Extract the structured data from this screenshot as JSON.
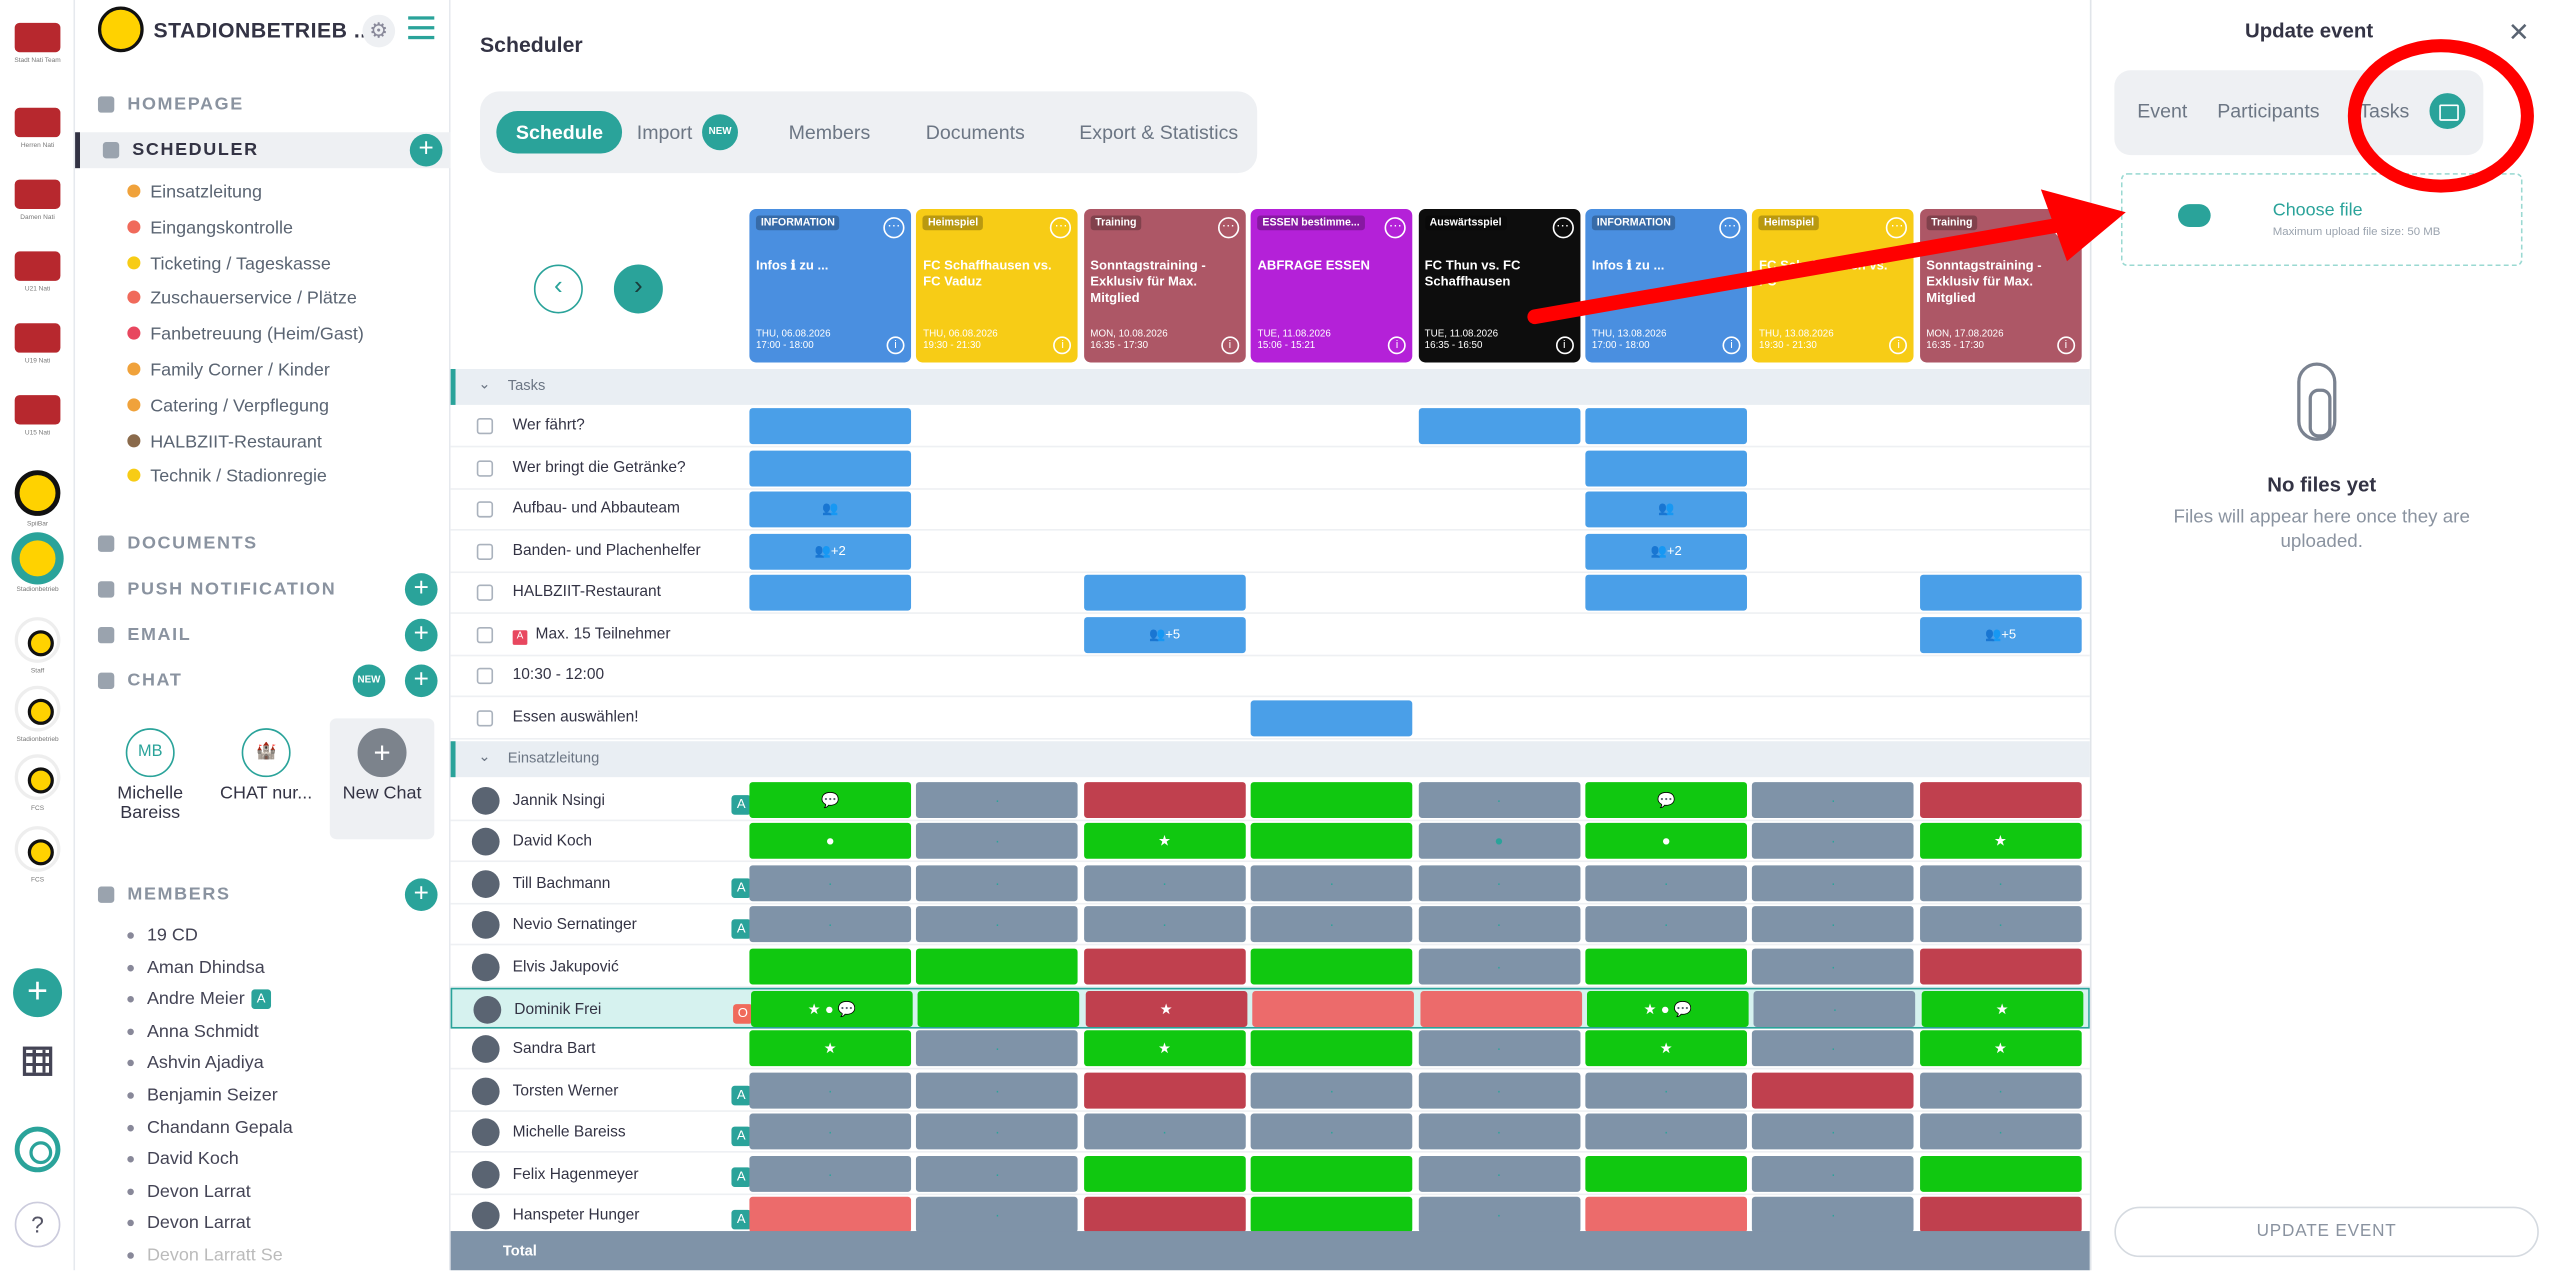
{
  "org": {
    "name": "STADIONBETRIEB ..."
  },
  "rail": {
    "teams": [
      "Stadt Nati Team",
      "Herren Nati",
      "Damen Nati",
      "U21 Nati",
      "U19 Nati",
      "U15 Nati",
      "SpiiBar",
      "Stadionbetrieb",
      "Staff",
      "Stadionbetrieb",
      "FCS",
      "FCS"
    ]
  },
  "nav": {
    "homepage": "HOMEPAGE",
    "scheduler": "SCHEDULER",
    "scheduler_items": [
      "Einsatzleitung",
      "Eingangskontrolle",
      "Ticketing / Tageskasse",
      "Zuschauerservice / Plätze",
      "Fanbetreuung (Heim/Gast)",
      "Family Corner / Kinder",
      "Catering / Verpflegung",
      "HALBZIIT-Restaurant",
      "Technik / Stadionregie"
    ],
    "documents": "DOCUMENTS",
    "push": "PUSH NOTIFICATION",
    "email": "EMAIL",
    "chat": "CHAT",
    "new_badge": "NEW",
    "members": "MEMBERS"
  },
  "chats": [
    {
      "initials": "MB",
      "name": "Michelle Bareiss"
    },
    {
      "initials": "🏰",
      "name": "CHAT nur..."
    },
    {
      "initials": "+",
      "name": "New Chat"
    }
  ],
  "members": [
    "19 CD",
    "Aman Dhindsa",
    "Andre Meier",
    "Anna Schmidt",
    "Ashvin Ajadiya",
    "Benjamin Seizer",
    "Chandann Gepala",
    "David Koch",
    "Devon Larrat",
    "Devon Larrat",
    "Devon Larratt Se"
  ],
  "main": {
    "title": "Scheduler",
    "tabs": [
      "Schedule",
      "Import",
      "Members",
      "Documents",
      "Export & Statistics"
    ]
  },
  "events": [
    {
      "tag": "INFORMATION",
      "name": "Infos ℹ zu ...",
      "date": "THU, 06.08.2026",
      "time": "17:00 - 18:00",
      "color": "#4a8fe0"
    },
    {
      "tag": "Heimspiel",
      "name": "FC Schaffhausen vs. FC Vaduz",
      "date": "THU, 06.08.2026",
      "time": "19:30 - 21:30",
      "color": "#f7cc16"
    },
    {
      "tag": "Training",
      "name": "Sonntagstraining - Exklusiv für Max. Mitglied",
      "date": "MON, 10.08.2026",
      "time": "16:35 - 17:30",
      "color": "#ad5766"
    },
    {
      "tag": "ESSEN bestimme...",
      "name": "ABFRAGE ESSEN",
      "date": "TUE, 11.08.2026",
      "time": "15:06 - 15:21",
      "color": "#b421d8"
    },
    {
      "tag": "Auswärtsspiel",
      "name": "FC Thun vs. FC Schaffhausen",
      "date": "TUE, 11.08.2026",
      "time": "16:35 - 16:50",
      "color": "#0d0d0d"
    },
    {
      "tag": "INFORMATION",
      "name": "Infos ℹ zu ...",
      "date": "THU, 13.08.2026",
      "time": "17:00 - 18:00",
      "color": "#4a8fe0"
    },
    {
      "tag": "Heimspiel",
      "name": "FC Schaffhausen vs. FC",
      "date": "THU, 13.08.2026",
      "time": "19:30 - 21:30",
      "color": "#f7cc16"
    },
    {
      "tag": "Training",
      "name": "Sonntagstraining - Exklusiv für Max. Mitglied",
      "date": "MON, 17.08.2026",
      "time": "16:35 - 17:30",
      "color": "#ad5766"
    }
  ],
  "sections": {
    "tasks": "Tasks",
    "einsatz": "Einsatzleitung",
    "total": "Total"
  },
  "tasks": [
    {
      "label": "Wer fährt?",
      "cells": [
        0,
        4,
        5
      ]
    },
    {
      "label": "Wer bringt die Getränke?",
      "cells": [
        0,
        5
      ]
    },
    {
      "label": "Aufbau- und Abbauteam",
      "cells": [
        0,
        5
      ],
      "icons": {
        "0": "👥",
        "5": "👥"
      }
    },
    {
      "label": "Banden- und Plachenhelfer",
      "cells": [
        0,
        5
      ],
      "icons": {
        "0": "👥+2",
        "5": "👥+2"
      }
    },
    {
      "label": "HALBZIIT-Restaurant",
      "cells": [
        0,
        2,
        5,
        7
      ]
    },
    {
      "label": "Max. 15 Teilnehmer",
      "badge": "A",
      "cells": [
        2,
        7
      ],
      "icons": {
        "2": "👥+5",
        "7": "👥+5"
      }
    },
    {
      "label": "10:30 - 12:00",
      "cells": []
    },
    {
      "label": "Essen auswählen!",
      "cells": [
        3
      ]
    }
  ],
  "people": [
    {
      "name": "Jannik Nsingi",
      "badges": [
        "A",
        "A"
      ],
      "cells": "gsrgsgsr",
      "marks": {
        "0": "💬",
        "5": "💬"
      }
    },
    {
      "name": "David Koch",
      "badges": [],
      "cells": "gsggsgsg",
      "marks": {
        "0": "●",
        "2": "★",
        "4": "●",
        "5": "●",
        "7": "★"
      }
    },
    {
      "name": "Till Bachmann",
      "badges": [
        "A"
      ],
      "cells": "ssssssss",
      "marks": {}
    },
    {
      "name": "Nevio Sernatinger",
      "badges": [
        "A"
      ],
      "cells": "ssssssss",
      "marks": {}
    },
    {
      "name": "Elvis Jakupović",
      "badges": [],
      "cells": "ggrgsgsr",
      "marks": {}
    },
    {
      "name": "Dominik Frei",
      "badges": [
        "O"
      ],
      "cells": "ggrppgsg",
      "marks": {
        "0": "★ ● 💬",
        "2": "★",
        "5": "★ ● 💬",
        "7": "★"
      }
    },
    {
      "name": "Sandra Bart",
      "badges": [],
      "cells": "gsggsgsg",
      "marks": {
        "0": "★",
        "2": "★",
        "5": "★",
        "7": "★"
      }
    },
    {
      "name": "Torsten Werner",
      "badges": [
        "A"
      ],
      "cells": "ssrsssr s",
      "marks": {}
    },
    {
      "name": "Michelle Bareiss",
      "badges": [
        "A"
      ],
      "cells": "ssssssss",
      "marks": {}
    },
    {
      "name": "Felix Hagenmeyer",
      "badges": [
        "A"
      ],
      "cells": "ssggsgsg",
      "marks": {}
    },
    {
      "name": "Hanspeter Hunger",
      "badges": [
        "A"
      ],
      "cells": "psrgspsr",
      "marks": {}
    }
  ],
  "panel": {
    "title": "Update event",
    "tabs": [
      "Event",
      "Participants",
      "Tasks"
    ],
    "choose_file": "Choose file",
    "max_size": "Maximum upload file size: 50 MB",
    "no_files": "No files yet",
    "no_files_sub": "Files will appear here once they are uploaded.",
    "update_button": "UPDATE EVENT"
  }
}
